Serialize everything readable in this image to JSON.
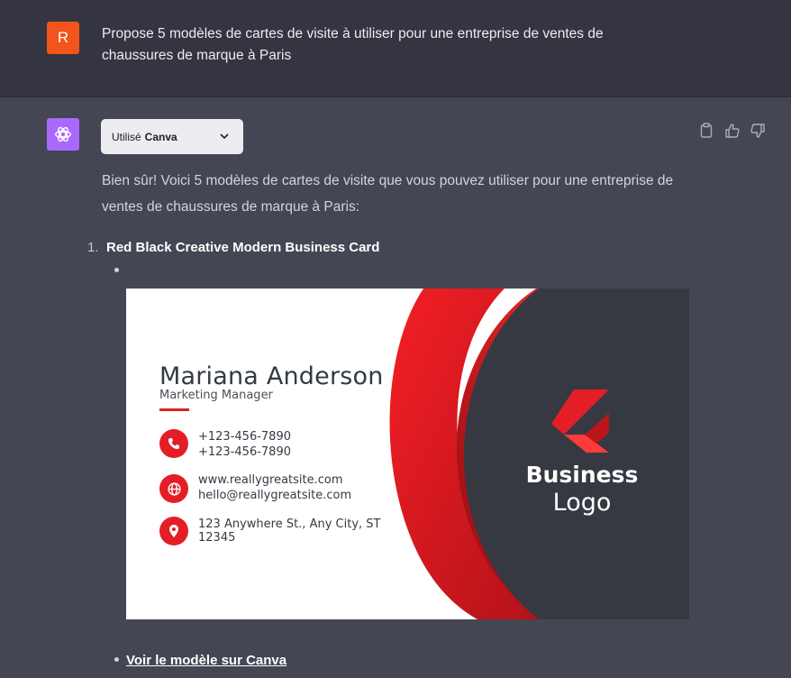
{
  "user_message": {
    "avatar_letter": "R",
    "line1": "Propose 5 modèles de cartes de visite à utiliser pour une entreprise de ventes de",
    "line2": "chaussures de marque à Paris"
  },
  "assistant_message": {
    "plugin": {
      "prefix": "Utilisé",
      "name": "Canva"
    },
    "intro_line1": "Bien sûr! Voici 5 modèles de cartes de visite que vous pouvez utiliser pour une entreprise de",
    "intro_line2": "ventes de chaussures de marque à Paris:",
    "items": [
      {
        "number": "1.",
        "title": "Red Black Creative Modern Business Card",
        "link_text": "Voir le modèle sur Canva"
      }
    ]
  },
  "card": {
    "name": "Mariana Anderson",
    "role": "Marketing Manager",
    "phone1": "+123-456-7890",
    "phone2": "+123-456-7890",
    "website": "www.reallygreatsite.com",
    "email": "hello@reallygreatsite.com",
    "address1": "123 Anywhere St., Any City, ST",
    "address2": "12345",
    "logo_line1": "Business",
    "logo_line2": "Logo"
  },
  "colors": {
    "page_bg": "#444654",
    "user_bg": "#343541",
    "user_avatar": "#f2541c",
    "bot_avatar": "#ab68ff",
    "card_red": "#e41e26",
    "card_dark": "#363942"
  },
  "icons": [
    "openai-logo-icon",
    "chevron-down-icon",
    "clipboard-icon",
    "thumbs-up-icon",
    "thumbs-down-icon",
    "phone-icon",
    "globe-icon",
    "location-pin-icon"
  ]
}
